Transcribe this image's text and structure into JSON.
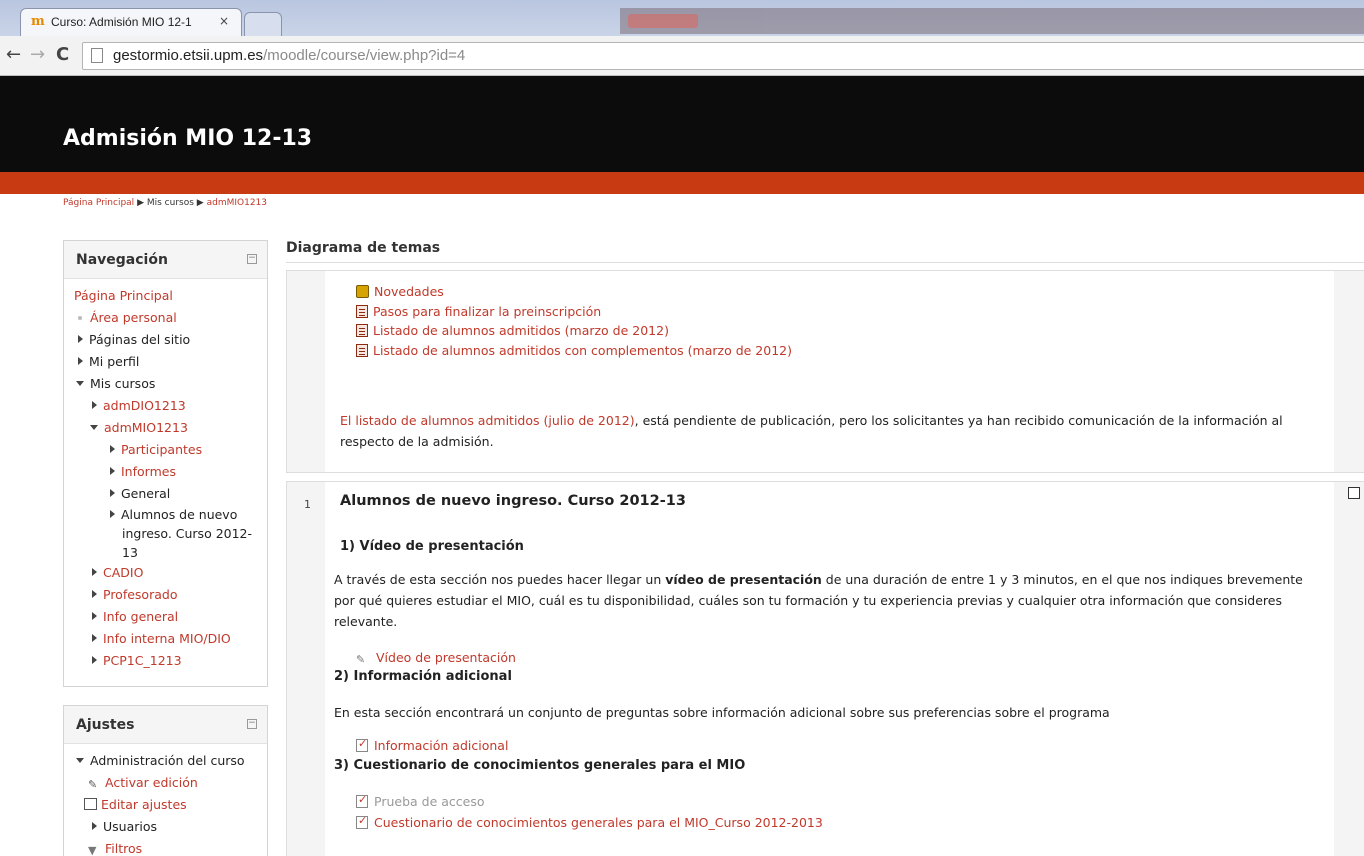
{
  "browser": {
    "tab_title": "Curso: Admisión MIO 12-1",
    "tab_close": "×",
    "url_host": "gestormio.etsii.upm.es",
    "url_path": "/moodle/course/view.php?id=4",
    "back": "←",
    "forward": "→",
    "reload": "C"
  },
  "header": {
    "course_title": "Admisión MIO 12-13"
  },
  "breadcrumb": {
    "home": "Página Principal",
    "sep": "▶",
    "my_courses": "Mis cursos",
    "current": "admMIO1213"
  },
  "nav_block": {
    "title": "Navegación",
    "collapse": "−",
    "items": {
      "home": "Página Principal",
      "personal": "Área personal",
      "site_pages": "Páginas del sitio",
      "profile": "Mi perfil",
      "my_courses": "Mis cursos",
      "c_admdio": "admDIO1213",
      "c_admmio": "admMIO1213",
      "participants": "Participantes",
      "reports": "Informes",
      "general": "General",
      "alumnos_line1": "Alumnos de nuevo",
      "alumnos_line2": "ingreso. Curso 2012-",
      "alumnos_line3": "13",
      "cadio": "CADIO",
      "profesorado": "Profesorado",
      "info_general": "Info general",
      "info_interna": "Info interna MIO/DIO",
      "pcp": "PCP1C_1213"
    }
  },
  "settings_block": {
    "title": "Ajustes",
    "collapse": "−",
    "items": {
      "admin": "Administración del curso",
      "edit_on": "Activar edición",
      "edit_settings": "Editar ajustes",
      "users": "Usuarios",
      "filters": "Filtros"
    }
  },
  "main": {
    "title": "Diagrama de temas",
    "section0": {
      "resources": [
        "Novedades",
        "Pasos para finalizar la preinscripción",
        "Listado de alumnos admitidos (marzo de 2012)",
        "Listado de alumnos admitidos con complementos (marzo de 2012)"
      ],
      "note_link": "El listado de alumnos admitidos (julio de 2012)",
      "note_text_1": ", está pendiente de publicación, pero los solicitantes ya han recibido comunicación de la información al",
      "note_text_2": "respecto de la admisión."
    },
    "section1": {
      "number": "1",
      "title": "Alumnos de nuevo ingreso. Curso 2012-13",
      "h_video": "1) Vídeo de presentación",
      "video_p_1a": "A través de esta sección nos puedes hacer llegar un ",
      "video_p_1b": "vídeo de presentación",
      "video_p_1c": " de una duración de entre 1 y 3 minutos, en el que nos indiques brevemente",
      "video_p_2": "por qué quieres estudiar el MIO, cuál es tu disponibilidad, cuáles son tu formación y tu experiencia previas y cualquier otra información que consideres",
      "video_p_3": "relevante.",
      "video_link": "Vídeo de presentación",
      "h_info": "2) Información adicional",
      "info_p": "En esta sección encontrará un conjunto de preguntas sobre información adicional sobre sus preferencias sobre el programa",
      "info_link": "Información adicional",
      "h_quiz": "3) Cuestionario de conocimientos generales para el MIO",
      "quiz_dim": "Prueba de acceso",
      "quiz_link": "Cuestionario de conocimientos generales para el MIO_Curso 2012-2013"
    }
  }
}
